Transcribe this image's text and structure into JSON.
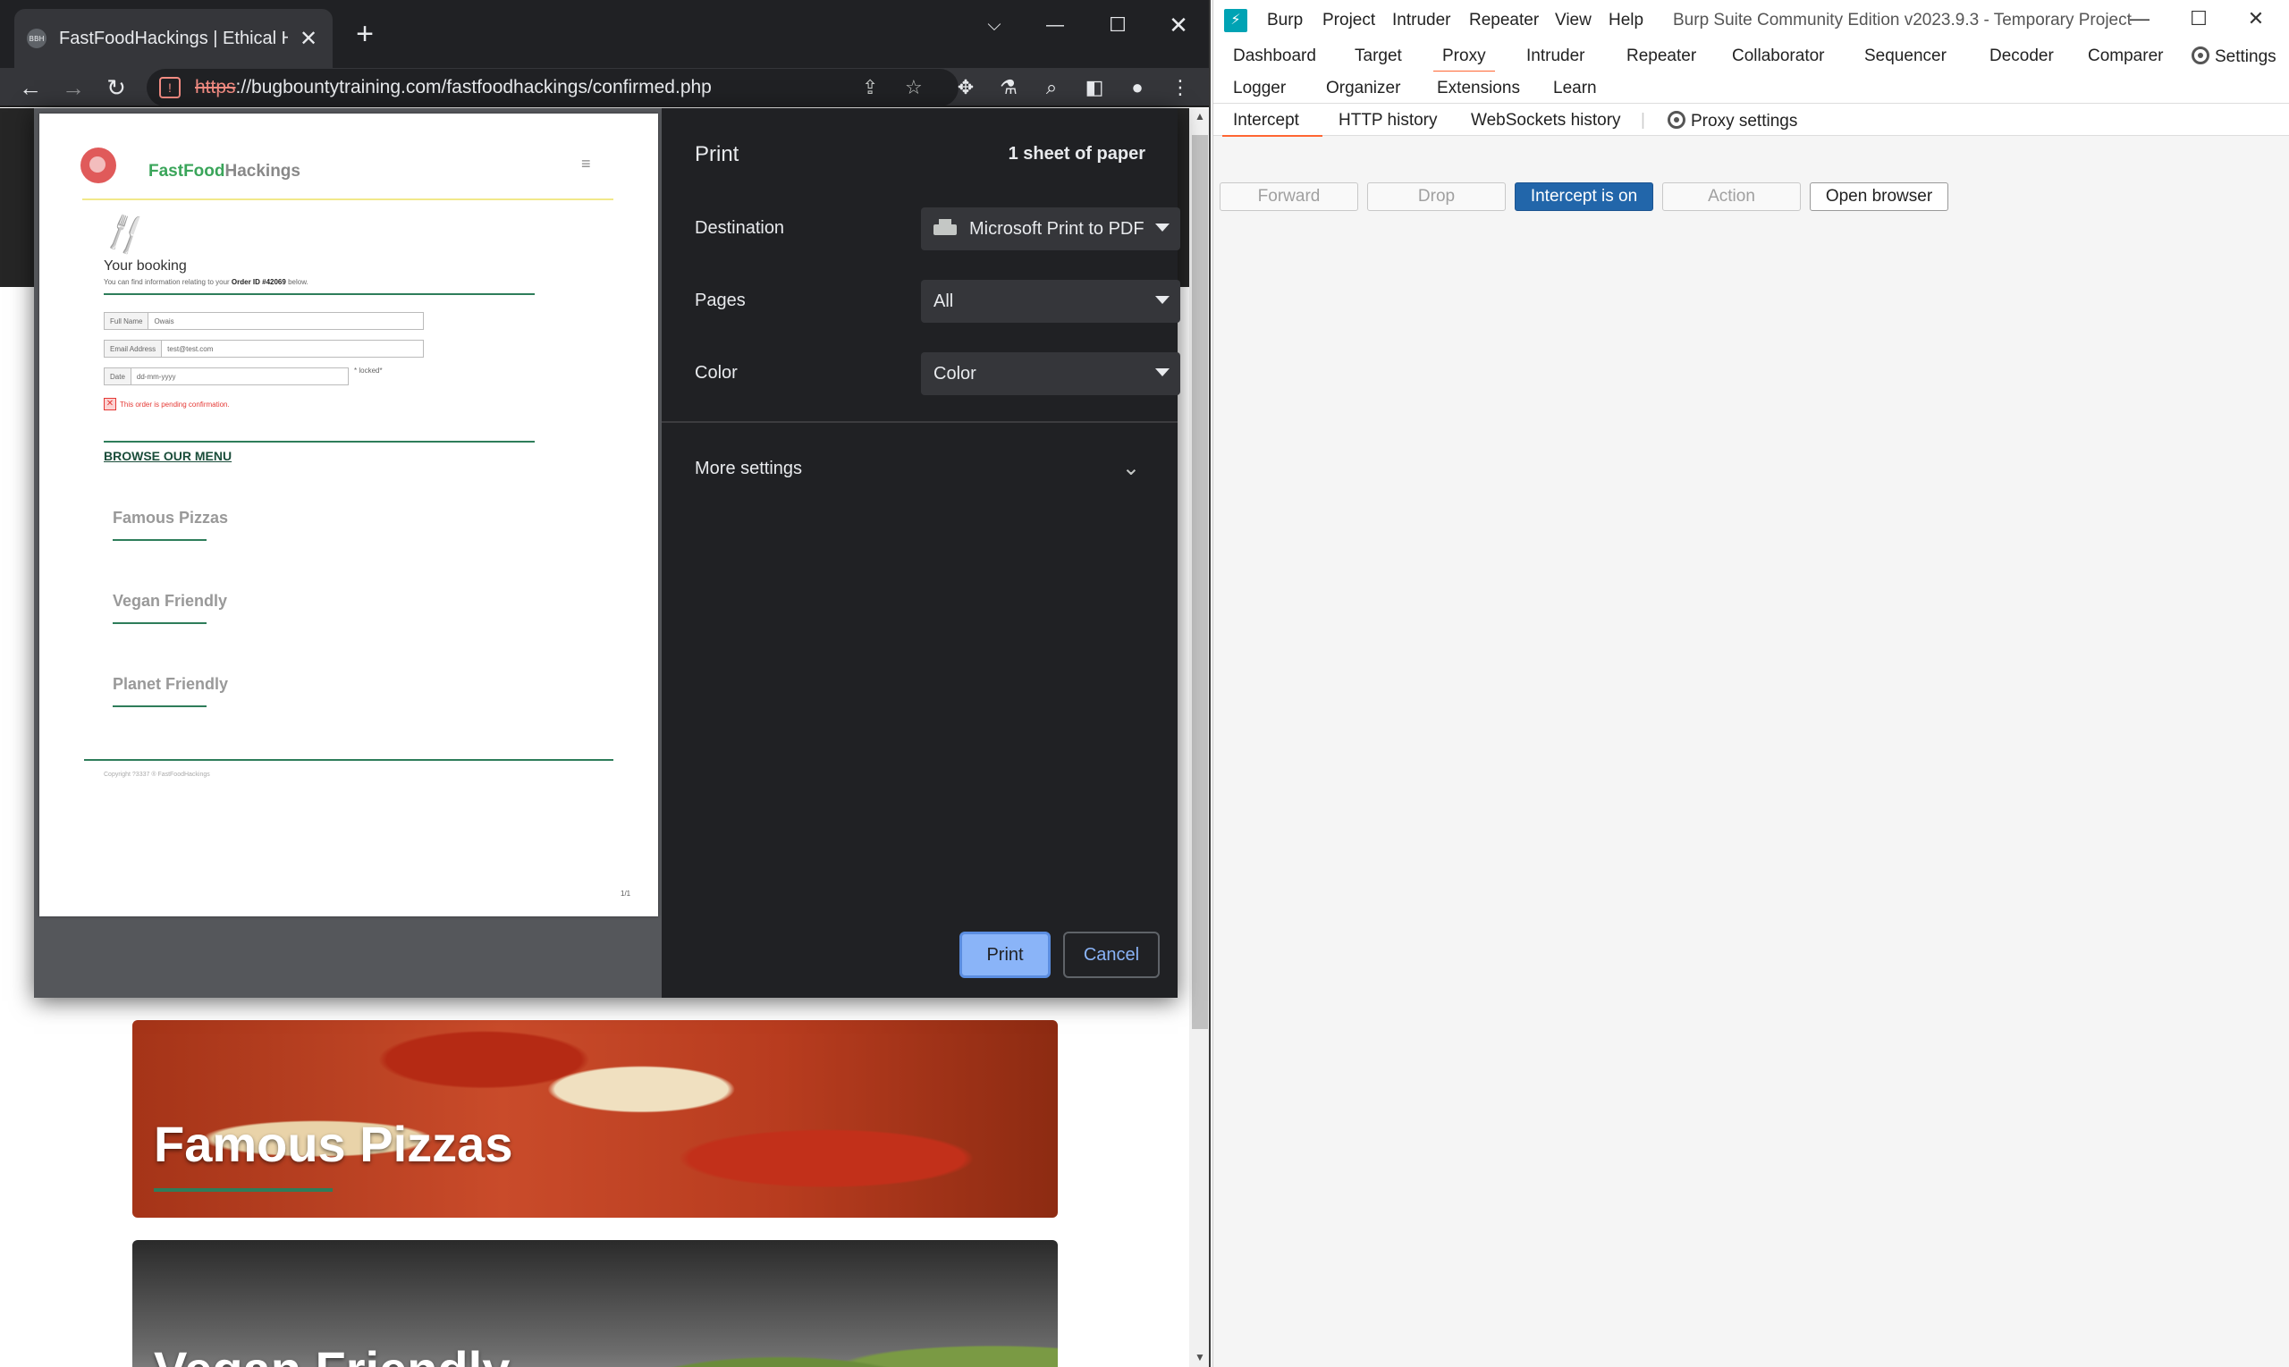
{
  "browser": {
    "tab": {
      "favicon_text": "BBH",
      "title": "FastFoodHackings | Ethical Hacke",
      "close": "✕"
    },
    "new_tab": "+",
    "url_scheme": "https",
    "url_rest": "://bugbountytraining.com/fastfoodhackings/confirmed.php",
    "window_controls": {
      "tab_search": "⌵",
      "minimize": "—",
      "maximize": "☐",
      "close": "✕"
    },
    "nav": {
      "back": "←",
      "forward": "→",
      "reload": "↻"
    },
    "icons": {
      "share": "⇪",
      "star": "☆",
      "extensions": "✥",
      "labs": "⚗",
      "search": "⌕",
      "sidepanel": "◧",
      "profile": "●",
      "menu": "⋮"
    },
    "page": {
      "menu_images": [
        {
          "label": "Famous Pizzas"
        },
        {
          "label": "Vegan Friendly"
        }
      ]
    }
  },
  "print_dialog": {
    "title": "Print",
    "sheets": "1 sheet of paper",
    "destination": {
      "label": "Destination",
      "value": "Microsoft Print to PDF"
    },
    "pages": {
      "label": "Pages",
      "value": "All"
    },
    "color": {
      "label": "Color",
      "value": "Color"
    },
    "more_settings": "More settings",
    "more_chevron": "⌄",
    "print_button": "Print",
    "cancel_button": "Cancel",
    "preview": {
      "logo_part1": "FastFood",
      "logo_part2": "Hackings",
      "hamburger": "≡",
      "heading": "Your booking",
      "sub_text": "You can find information relating to your ",
      "order_id": "Order ID #42069",
      "sub_tail": " below.",
      "fields": [
        {
          "label": "Full Name",
          "value": "Owais"
        },
        {
          "label": "Email Address",
          "value": "test@test.com"
        },
        {
          "label": "Date",
          "value": "dd-mm-yyyy"
        }
      ],
      "locked": "* locked*",
      "error": "This order is pending confirmation.",
      "browse": "BROWSE OUR MENU",
      "categories": [
        "Famous Pizzas",
        "Vegan Friendly",
        "Planet Friendly"
      ],
      "copyright": "Copyright ?3337 ® FastFoodHackings",
      "page_number": "1/1"
    }
  },
  "burp": {
    "icon": "⚡",
    "menu": [
      "Burp",
      "Project",
      "Intruder",
      "Repeater",
      "View",
      "Help"
    ],
    "app_title": "Burp Suite Community Edition v2023.9.3 - Temporary Project",
    "window_controls": {
      "minimize": "—",
      "maximize": "☐",
      "close": "✕"
    },
    "tabs_row1": [
      "Dashboard",
      "Target",
      "Proxy",
      "Intruder",
      "Repeater",
      "Collaborator",
      "Sequencer",
      "Decoder",
      "Comparer",
      "Settings"
    ],
    "tabs_row2": [
      "Logger",
      "Organizer",
      "Extensions",
      "Learn"
    ],
    "active_tab": "Proxy",
    "subtabs": [
      "Intercept",
      "HTTP history",
      "WebSockets history",
      "Proxy settings"
    ],
    "buttons": {
      "forward": "Forward",
      "drop": "Drop",
      "intercept": "Intercept is on",
      "action": "Action",
      "open_browser": "Open browser"
    },
    "colors": {
      "accent": "#ff6633",
      "intercept_on": "#2266aa"
    }
  }
}
